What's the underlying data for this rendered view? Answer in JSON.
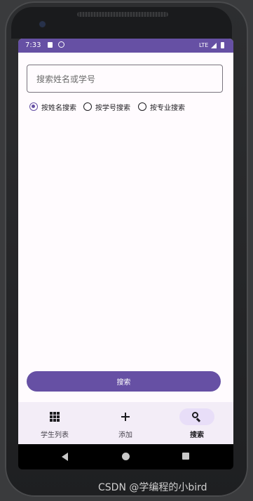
{
  "status_bar": {
    "time": "7:33",
    "network": "LTE"
  },
  "search": {
    "placeholder": "搜索姓名或学号",
    "value": ""
  },
  "radio_options": [
    {
      "label": "按姓名搜索",
      "checked": true
    },
    {
      "label": "按学号搜索",
      "checked": false
    },
    {
      "label": "按专业搜索",
      "checked": false
    }
  ],
  "search_button": {
    "label": "搜索"
  },
  "bottom_nav": {
    "items": [
      {
        "label": "学生列表",
        "icon": "grid-icon",
        "active": false
      },
      {
        "label": "添加",
        "icon": "plus-icon",
        "active": false
      },
      {
        "label": "搜索",
        "icon": "search-icon",
        "active": true
      }
    ]
  },
  "watermark": "CSDN @学编程的小bird",
  "colors": {
    "primary": "#6650a4",
    "nav_background": "#f3edf7",
    "active_indicator": "#e8def8",
    "screen_background": "#fffbfe"
  }
}
